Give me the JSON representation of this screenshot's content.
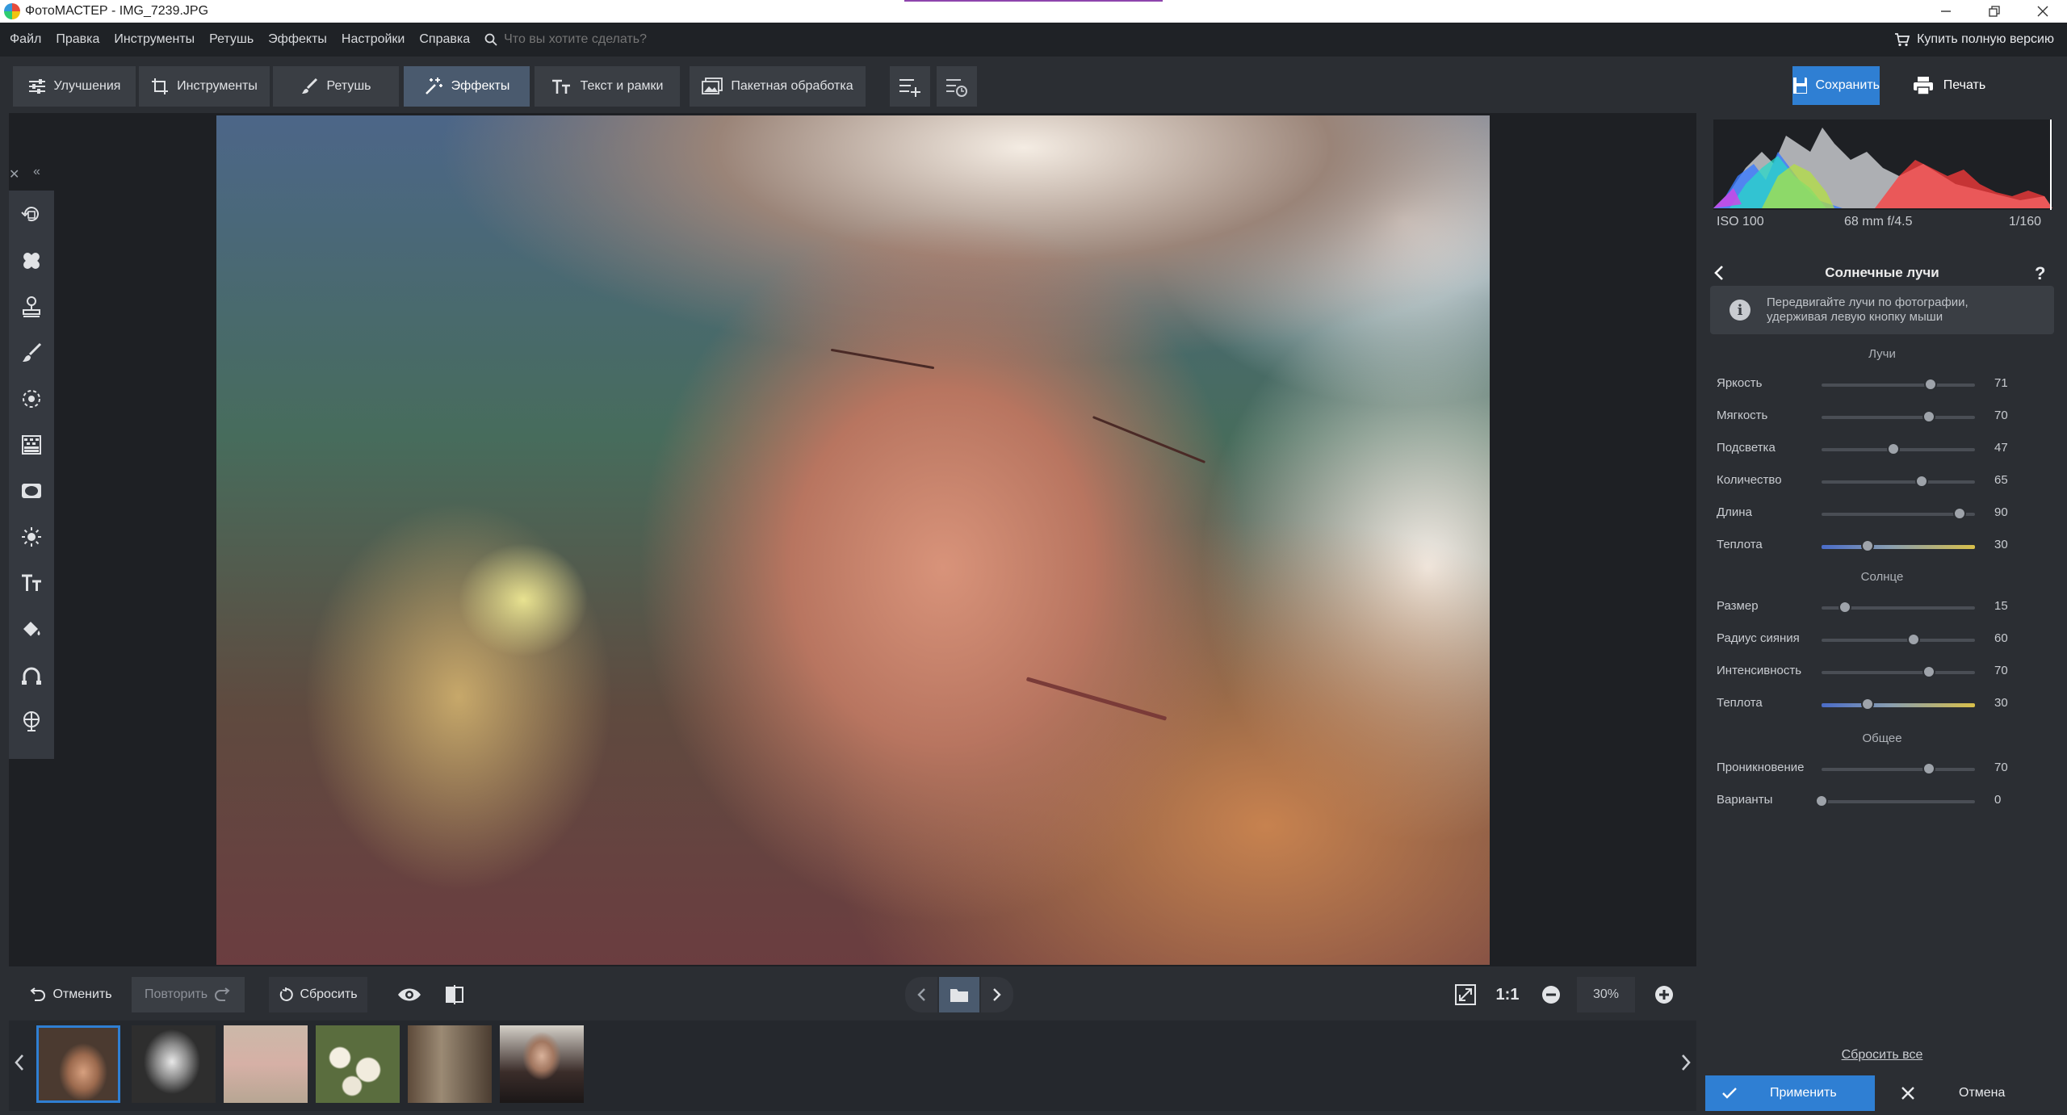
{
  "window": {
    "title": "ФотоМАСТЕР - IMG_7239.JPG"
  },
  "menu": {
    "items": [
      "Файл",
      "Правка",
      "Инструменты",
      "Ретушь",
      "Эффекты",
      "Настройки",
      "Справка"
    ],
    "search_placeholder": "Что вы хотите сделать?",
    "buy_label": "Купить полную версию"
  },
  "tabs": [
    {
      "label": "Улучшения",
      "icon": "sliders-icon"
    },
    {
      "label": "Инструменты",
      "icon": "crop-icon"
    },
    {
      "label": "Ретушь",
      "icon": "brush-icon"
    },
    {
      "label": "Эффекты",
      "icon": "magic-wand-icon",
      "active": true
    },
    {
      "label": "Текст и рамки",
      "icon": "text-icon"
    },
    {
      "label": "Пакетная обработка",
      "icon": "batch-icon"
    }
  ],
  "actions": {
    "save": "Сохранить",
    "print": "Печать"
  },
  "left_tools": [
    "rotate-icon",
    "healing-patch-icon",
    "stamp-icon",
    "brush-icon",
    "radial-filter-icon",
    "gradient-filter-icon",
    "vignette-icon",
    "light-icon",
    "text-icon",
    "fill-icon",
    "curve-icon",
    "globe-icon"
  ],
  "bottom": {
    "undo": "Отменить",
    "redo": "Повторить",
    "reset": "Сбросить",
    "zoom_1to1": "1:1",
    "zoom_level": "30%"
  },
  "right_panel": {
    "exif": {
      "iso": "ISO 100",
      "lens": "68 mm f/4.5",
      "shutter": "1/160"
    },
    "effect_title": "Солнечные лучи",
    "help": "?",
    "hint": "Передвигайте лучи по фотографии, удерживая левую кнопку мыши",
    "groups": [
      {
        "title": "Лучи",
        "sliders": [
          {
            "label": "Яркость",
            "value": 71
          },
          {
            "label": "Мягкость",
            "value": 70
          },
          {
            "label": "Подсветка",
            "value": 47
          },
          {
            "label": "Количество",
            "value": 65
          },
          {
            "label": "Длина",
            "value": 90
          },
          {
            "label": "Теплота",
            "value": 30,
            "warm": true
          }
        ]
      },
      {
        "title": "Солнце",
        "sliders": [
          {
            "label": "Размер",
            "value": 15
          },
          {
            "label": "Радиус сияния",
            "value": 60
          },
          {
            "label": "Интенсивность",
            "value": 70
          },
          {
            "label": "Теплота",
            "value": 30,
            "warm": true
          }
        ]
      },
      {
        "title": "Общее",
        "sliders": [
          {
            "label": "Проникновение",
            "value": 70
          },
          {
            "label": "Варианты",
            "value": 0
          }
        ]
      }
    ],
    "reset_all": "Сбросить все",
    "apply": "Применить",
    "cancel": "Отмена"
  },
  "colors": {
    "accent": "#2f7fd3",
    "panel": "#2b2e33",
    "canvas": "#1e2024"
  }
}
